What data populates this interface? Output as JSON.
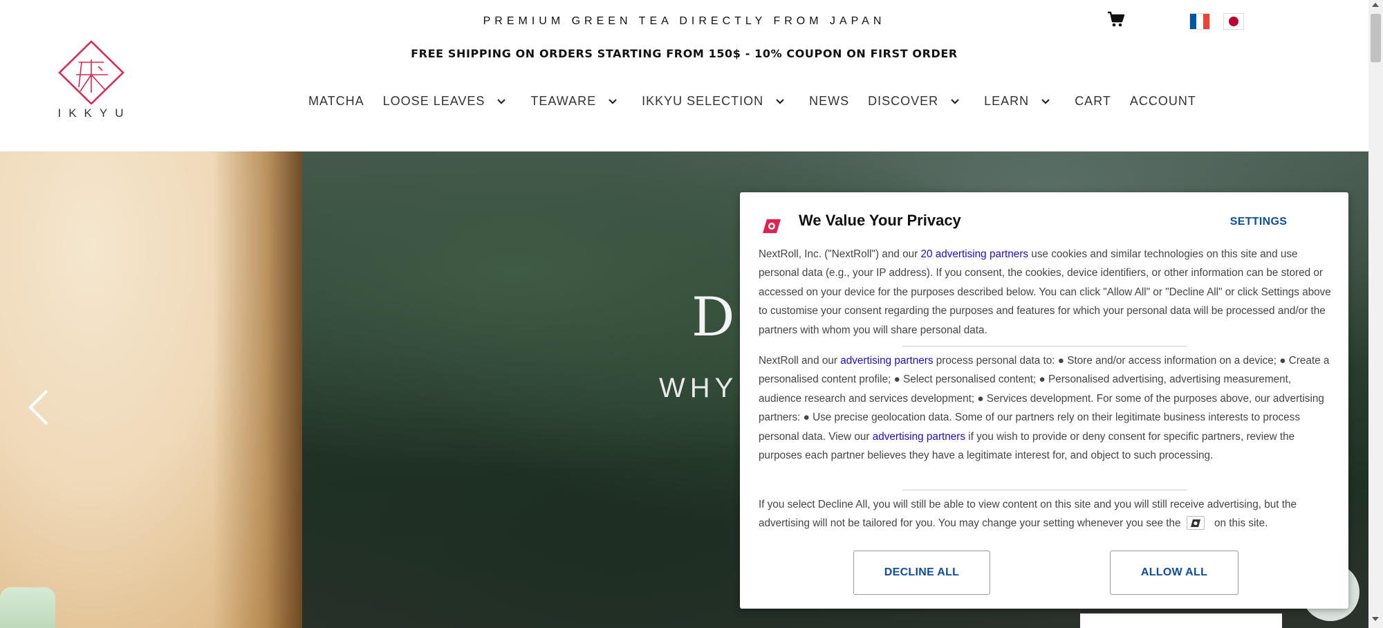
{
  "header": {
    "tagline": "PREMIUM GREEN TEA DIRECTLY FROM JAPAN",
    "shipping": "FREE SHIPPING ON ORDERS STARTING FROM 150$ - 10% COUPON ON FIRST ORDER",
    "logo_text": "IKKYU",
    "icons": {
      "cart": "cart-icon",
      "flags": [
        "flag-france-icon",
        "flag-japan-icon"
      ]
    }
  },
  "nav": {
    "items": [
      {
        "label": "MATCHA",
        "submenu": false
      },
      {
        "label": "LOOSE LEAVES",
        "submenu": true
      },
      {
        "label": "TEAWARE",
        "submenu": true
      },
      {
        "label": "IKKYU SELECTION",
        "submenu": true
      },
      {
        "label": "NEWS",
        "submenu": false
      },
      {
        "label": "DISCOVER",
        "submenu": true
      },
      {
        "label": "LEARN",
        "submenu": true
      },
      {
        "label": "CART",
        "submenu": false
      },
      {
        "label": "ACCOUNT",
        "submenu": false
      }
    ]
  },
  "hero": {
    "title_visible": "DI",
    "subtitle_visible": "WHY"
  },
  "consent": {
    "title": "We Value Your Privacy",
    "settings_label": "SETTINGS",
    "p1": {
      "before": "NextRoll, Inc. (\"NextRoll\") and our ",
      "link": "20 advertising partners",
      "after": " use cookies and similar technologies on this site and use personal data (e.g., your IP address). If you consent, the cookies, device identifiers, or other information can be stored or accessed on your device for the purposes described below. You can click \"Allow All\" or \"Decline All\" or click Settings above to customise your consent regarding the purposes and features for which your personal data will be processed and/or the partners with whom you will share personal data."
    },
    "p2": {
      "before": "NextRoll and our ",
      "link1": "advertising partners",
      "middle": " process personal data to: ● Store and/or access information on a device; ● Create a personalised content profile; ● Select personalised content; ● Personalised advertising, advertising measurement, audience research and services development; ● Services development. For some of the purposes above, our advertising partners: ● Use precise geolocation data. Some of our partners rely on their legitimate business interests to process personal data. View our ",
      "link2": "advertising partners",
      "after": " if you wish to provide or deny consent for specific partners, review the purposes each partner believes they have a legitimate interest for, and object to such processing."
    },
    "p3": {
      "before": "If you select Decline All, you will still be able to view content on this site and you will still receive advertising, but the advertising will not be tailored for you. You may change your setting whenever you see the ",
      "after": " on this site."
    },
    "decline_label": "DECLINE ALL",
    "allow_label": "ALLOW ALL",
    "colors": {
      "button_text": "#0d4da1",
      "link": "#1a0dcc",
      "logo": "#e0234e"
    }
  },
  "colors": {
    "logo_red": "#e0234e"
  }
}
